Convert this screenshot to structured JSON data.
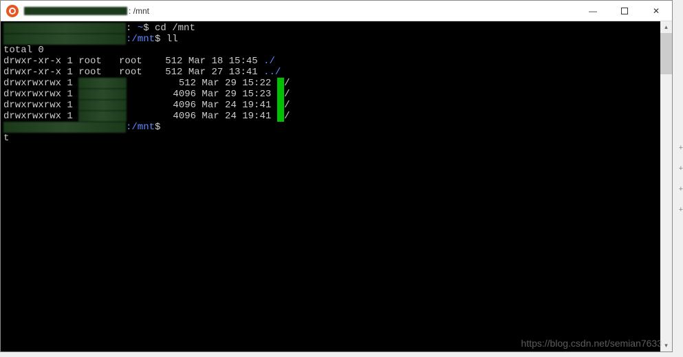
{
  "window": {
    "title_suffix": ": /mnt"
  },
  "terminal": {
    "prompt_tilde": "~",
    "prompt_sep": ": ",
    "prompt_dollar": "$ ",
    "prompt_path": ":/mnt",
    "cmd1": "cd /mnt",
    "cmd2": "ll",
    "lines": {
      "total": "total 0",
      "l1_perm": "drwxr-xr-x 1 root   root    512 Mar 18 15:45 ",
      "l1_name": "./",
      "l2_perm": "drwxr-xr-x 1 root   root    512 Mar 27 13:41 ",
      "l2_name": "../",
      "l3_perm": "drwxrwxrwx 1 ",
      "l3_mid": "         512 Mar 29 15:22 ",
      "l3_slash": "/",
      "l4_perm": "drwxrwxrwx 1 ",
      "l4_mid": "        4096 Mar 29 15:23 ",
      "l4_slash": "/",
      "l5_perm": "drwxrwxrwx 1 ",
      "l5_mid": "        4096 Mar 24 19:41 ",
      "l5_slash": "/",
      "l6_perm": "drwxrwxrwx 1 ",
      "l6_mid": "        4096 Mar 24 19:41 ",
      "l6_slash": "/"
    },
    "cursor_char": "t"
  },
  "watermark": "https://blog.csdn.net/semian7633",
  "icons": {
    "minimize": "—",
    "close": "✕"
  }
}
